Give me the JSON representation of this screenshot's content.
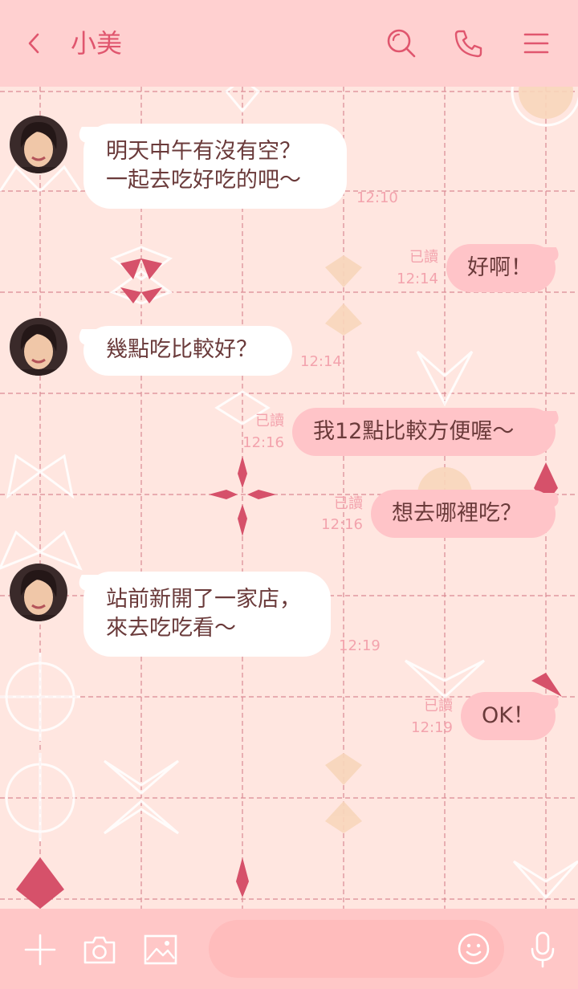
{
  "header": {
    "title": "小美"
  },
  "messages": [
    {
      "side": "in",
      "lines": [
        "明天中午有沒有空？",
        "一起去吃好吃的吧～"
      ],
      "time": "12:10"
    },
    {
      "side": "out",
      "lines": [
        "好啊！"
      ],
      "read": "已讀",
      "time": "12:14"
    },
    {
      "side": "in",
      "lines": [
        "幾點吃比較好？"
      ],
      "time": "12:14"
    },
    {
      "side": "out",
      "lines": [
        "我12點比較方便喔～"
      ],
      "read": "已讀",
      "time": "12:16"
    },
    {
      "side": "out",
      "lines": [
        "想去哪裡吃？"
      ],
      "read": "已讀",
      "time": "12:16"
    },
    {
      "side": "in",
      "lines": [
        "站前新開了一家店，",
        "來去吃吃看～"
      ],
      "time": "12:19"
    },
    {
      "side": "out",
      "lines": [
        "OK！"
      ],
      "read": "已讀",
      "time": "12:19"
    }
  ],
  "footer": {
    "input_placeholder": ""
  },
  "icons": {
    "back": "chevron-left-icon",
    "search": "search-icon",
    "call": "phone-icon",
    "menu": "menu-icon",
    "add": "plus-icon",
    "camera": "camera-icon",
    "image": "image-icon",
    "emoji": "smile-icon",
    "mic": "microphone-icon"
  },
  "colors": {
    "header_bg": "#ffd0d0",
    "accent": "#e0566e",
    "chat_bg": "#ffe6e0",
    "out_bubble": "#ffc4c8",
    "in_bubble": "#ffffff",
    "meta_text": "#f3a3ad",
    "footer_bg": "#ffc7c7"
  }
}
